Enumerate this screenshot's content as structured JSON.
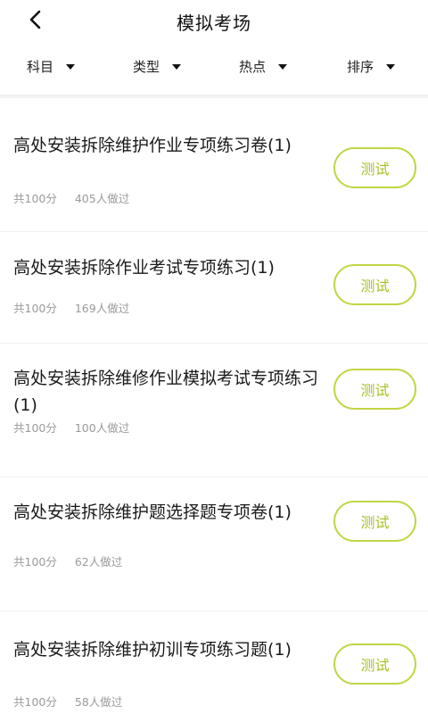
{
  "header": {
    "title": "模拟考场"
  },
  "filters": [
    {
      "label": "科目"
    },
    {
      "label": "类型"
    },
    {
      "label": "热点"
    },
    {
      "label": "排序"
    }
  ],
  "papers": [
    {
      "title": "高处安装拆除维护作业专项练习卷(1)",
      "score": "共100分",
      "count": "405人做过",
      "button": "测试"
    },
    {
      "title": "高处安装拆除作业考试专项练习(1)",
      "score": "共100分",
      "count": "169人做过",
      "button": "测试"
    },
    {
      "title": "高处安装拆除维修作业模拟考试专项练习(1)",
      "score": "共100分",
      "count": "100人做过",
      "button": "测试"
    },
    {
      "title": "高处安装拆除维护题选择题专项卷(1)",
      "score": "共100分",
      "count": "62人做过",
      "button": "测试"
    },
    {
      "title": "高处安装拆除维护初训专项练习题(1)",
      "score": "共100分",
      "count": "58人做过",
      "button": "测试"
    }
  ],
  "colors": {
    "accent_border": "#c2d544",
    "accent_text": "#a9be22",
    "meta_text": "#9a9a9a"
  }
}
